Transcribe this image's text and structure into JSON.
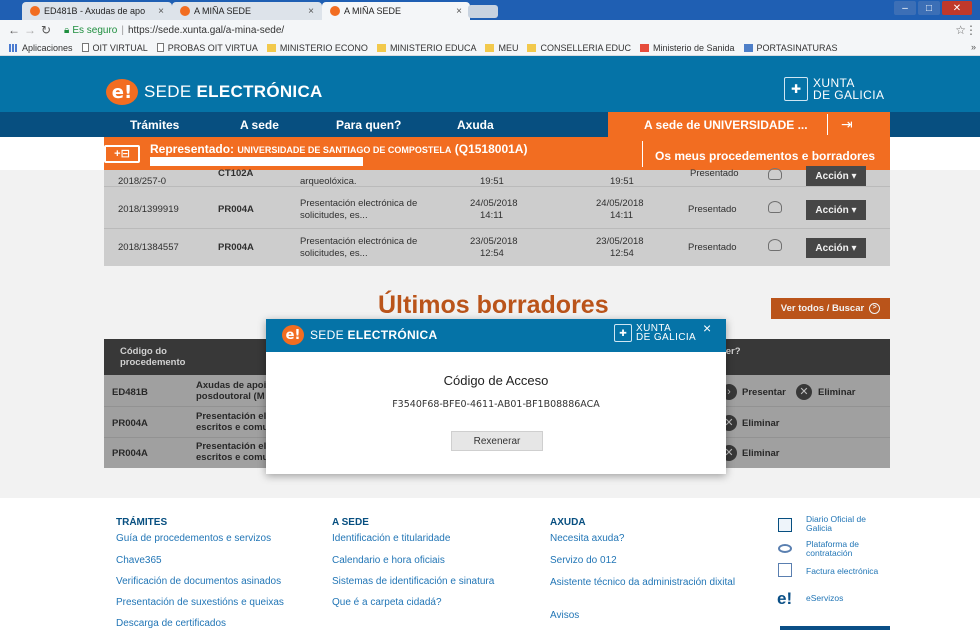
{
  "browser": {
    "tabs": [
      {
        "label": "ED481B - Axudas de apo",
        "close": "×"
      },
      {
        "label": "A MIÑA SEDE",
        "close": "×"
      },
      {
        "label": "A MIÑA SEDE",
        "close": "×"
      }
    ],
    "secure_label": "Es seguro",
    "url": "https://sede.xunta.gal/a-mina-sede/",
    "bookmarks": [
      {
        "label": "Aplicaciones",
        "icon": "apps-grid-icon"
      },
      {
        "label": "OIT VIRTUAL",
        "icon": "page-icon"
      },
      {
        "label": "PROBAS OIT VIRTUA",
        "icon": "page-icon"
      },
      {
        "label": "MINISTERIO ECONO",
        "icon": "folder-icon"
      },
      {
        "label": "MINISTERIO EDUCA",
        "icon": "folder-icon"
      },
      {
        "label": "MEU",
        "icon": "folder-icon"
      },
      {
        "label": "CONSELLERIA EDUC",
        "icon": "folder-icon"
      },
      {
        "label": "Ministerio de Sanida",
        "icon": "flag-icon"
      },
      {
        "label": "PORTASINATURAS",
        "icon": "web-icon"
      }
    ]
  },
  "header": {
    "logo_letter": "e!",
    "title_prefix": "SEDE ",
    "title_bold": "ELECTRÓNICA",
    "xunta_line1": "XUNTA",
    "xunta_line2": "DE GALICIA"
  },
  "nav": {
    "items": [
      "Trámites",
      "A sede",
      "Para quen?",
      "Axuda"
    ],
    "university": "A sede de UNIVERSIDADE ..."
  },
  "representado": {
    "label": "Representado:",
    "entity": "UNIVERSIDADE DE SANTIAGO DE COMPOSTELA",
    "code": "(Q1518001A)",
    "right": "Os meus procedementos e borradores"
  },
  "procedures": [
    {
      "id": "2018/257-0",
      "code": "CT102A",
      "desc1": "arqueolóxica.",
      "desc2": "",
      "date1": "",
      "time1": "19:51",
      "date2": "",
      "time2": "19:51",
      "status": "Presentado",
      "action": "Acción ▾"
    },
    {
      "id": "2018/1399919",
      "code": "PR004A",
      "desc1": "Presentación electrónica de",
      "desc2": "solicitudes, es...",
      "date1": "24/05/2018",
      "time1": "14:11",
      "date2": "24/05/2018",
      "time2": "14:11",
      "status": "Presentado",
      "action": "Acción ▾"
    },
    {
      "id": "2018/1384557",
      "code": "PR004A",
      "desc1": "Presentación electrónica de",
      "desc2": "solicitudes, es...",
      "date1": "23/05/2018",
      "time1": "12:54",
      "date2": "23/05/2018",
      "time2": "12:54",
      "status": "Presentado",
      "action": "Acción ▾"
    }
  ],
  "drafts": {
    "title": "Últimos borradores",
    "view_all": "Ver todos / Buscar",
    "col_code_line1": "Código do",
    "col_code_line2": "procedemento",
    "col_action": "facer?",
    "rows": [
      {
        "code": "ED481B",
        "desc1": "Axudas de apoi",
        "desc2": "posdoutoral (M",
        "present": "Presentar",
        "delete": "Eliminar"
      },
      {
        "code": "PR004A",
        "desc1": "Presentación el",
        "desc2": "escritos e comu",
        "present": "",
        "delete": "Eliminar"
      },
      {
        "code": "PR004A",
        "desc1": "Presentación el",
        "desc2": "escritos e comu",
        "present": "",
        "delete": "Eliminar"
      }
    ]
  },
  "modal": {
    "title_prefix": "SEDE ",
    "title_bold": "ELECTRÓNICA",
    "heading": "Código de Acceso",
    "code": "F3540F68-BFE0-4611-AB01-BF1B08886ACA",
    "button": "Rexenerar",
    "close": "×"
  },
  "footer": {
    "cols": [
      {
        "head": "TRÁMITES",
        "links": [
          "Guía de procedementos e servizos",
          "Chave365",
          "Verificación de documentos asinados",
          "Presentación de suxestións e queixas",
          "Descarga de certificados"
        ]
      },
      {
        "head": "A SEDE",
        "links": [
          "Identificación e titularidade",
          "Calendario e hora oficiais",
          "Sistemas de identificación e sinatura",
          "Que é a carpeta cidadá?"
        ]
      },
      {
        "head": "AXUDA",
        "links": [
          "Necesita axuda?",
          "Servizo do 012",
          "Asistente técnico da administración dixital",
          "Avisos"
        ]
      }
    ],
    "right_links": [
      {
        "line1": "Diario Oficial de",
        "line2": "Galicia"
      },
      {
        "line1": "Plataforma de",
        "line2": "contratación"
      },
      {
        "line1": "Factura electrónica",
        "line2": ""
      },
      {
        "line1": "eServizos",
        "line2": ""
      }
    ]
  }
}
